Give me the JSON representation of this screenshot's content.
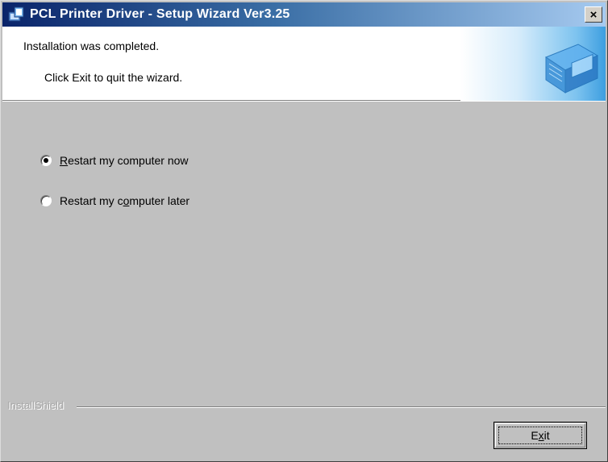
{
  "window": {
    "title": "PCL Printer Driver - Setup Wizard Ver3.25",
    "close_glyph": "×"
  },
  "header": {
    "title": "Installation was completed.",
    "subtitle": "Click Exit to quit the wizard."
  },
  "options": [
    {
      "label_pre": "",
      "label_key": "R",
      "label_post": "estart my computer now",
      "selected": true
    },
    {
      "label_pre": "Restart my c",
      "label_key": "o",
      "label_post": "mputer later",
      "selected": false
    }
  ],
  "footer": {
    "brand": "InstallShield",
    "exit_pre": "E",
    "exit_key": "x",
    "exit_post": "it"
  },
  "icons": {
    "title_icon": "setup-wizard-icon",
    "header_graphic": "computer-monitor-icon"
  }
}
